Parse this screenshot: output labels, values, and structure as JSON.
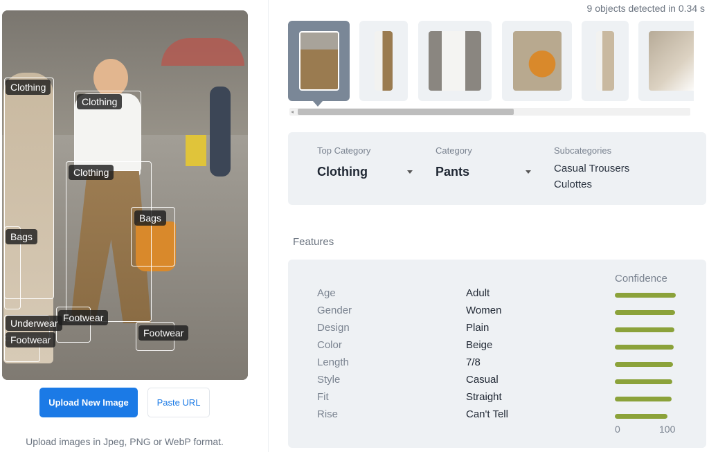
{
  "header": {
    "detected_text": "9 objects detected in 0.34 s"
  },
  "image": {
    "detections": [
      {
        "label": "Clothing"
      },
      {
        "label": "Clothing"
      },
      {
        "label": "Clothing"
      },
      {
        "label": "Bags"
      },
      {
        "label": "Bags"
      },
      {
        "label": "Underwear"
      },
      {
        "label": "Footwear"
      },
      {
        "label": "Footwear"
      },
      {
        "label": "Footwear"
      }
    ]
  },
  "actions": {
    "upload_label": "Upload New Image",
    "paste_label": "Paste URL",
    "hint": "Upload images in Jpeg, PNG or WebP format."
  },
  "thumbnails": [
    {
      "name": "thumb-pants",
      "active": true
    },
    {
      "name": "thumb-clothing-1",
      "active": false
    },
    {
      "name": "thumb-clothing-2",
      "active": false
    },
    {
      "name": "thumb-bag",
      "active": false
    },
    {
      "name": "thumb-partial",
      "active": false
    },
    {
      "name": "thumb-footwear",
      "active": false
    }
  ],
  "category": {
    "top_label": "Top Category",
    "top_value": "Clothing",
    "cat_label": "Category",
    "cat_value": "Pants",
    "sub_label": "Subcategories",
    "subcategories": [
      "Casual Trousers",
      "Culottes"
    ]
  },
  "features": {
    "title": "Features",
    "confidence_header": "Confidence",
    "scale_min": "0",
    "scale_max": "100",
    "rows": [
      {
        "name": "Age",
        "value": "Adult",
        "confidence": 96
      },
      {
        "name": "Gender",
        "value": "Women",
        "confidence": 95
      },
      {
        "name": "Design",
        "value": "Plain",
        "confidence": 93
      },
      {
        "name": "Color",
        "value": "Beige",
        "confidence": 92
      },
      {
        "name": "Length",
        "value": "7/8",
        "confidence": 91
      },
      {
        "name": "Style",
        "value": "Casual",
        "confidence": 90
      },
      {
        "name": "Fit",
        "value": "Straight",
        "confidence": 89
      },
      {
        "name": "Rise",
        "value": "Can't Tell",
        "confidence": 83
      }
    ]
  },
  "colors": {
    "accent": "#1b7ae6",
    "bar": "#8ba23a",
    "panel": "#eef1f4"
  }
}
